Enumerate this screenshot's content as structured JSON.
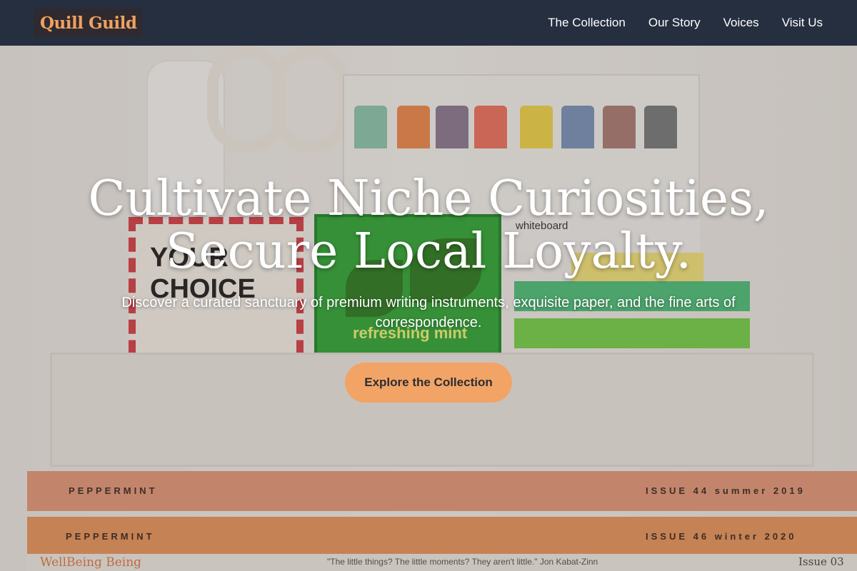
{
  "brand": {
    "name": "Quill Guild"
  },
  "nav": {
    "links": [
      "The Collection",
      "Our Story",
      "Voices",
      "Visit Us"
    ]
  },
  "hero": {
    "title": "Cultivate Niche Curiosities, Secure Local Loyalty.",
    "subtitle": "Discover a curated sanctuary of premium writing instruments, exquisite paper, and the fine arts of correspondence.",
    "cta_label": "Explore the Collection"
  },
  "background_text": {
    "card": "YOUR CHOICE",
    "whiteboard": "whiteboard",
    "tea": "refreshing mint",
    "book1_left": "PEPPERMINT",
    "book1_right": "ISSUE 44 summer 2019",
    "book2_left": "PEPPERMINT",
    "book2_right": "ISSUE 46 winter 2020",
    "book3_left": "WellBeing Being",
    "book3_mid": "\"The little things? The little moments? They aren't little.\" Jon Kabat-Zinn",
    "book3_right": "Issue 03"
  },
  "colors": {
    "navbar": "#252f40",
    "brand_accent": "#f1a160",
    "cta": "#f2a466",
    "cta_text": "#2d2d33"
  }
}
